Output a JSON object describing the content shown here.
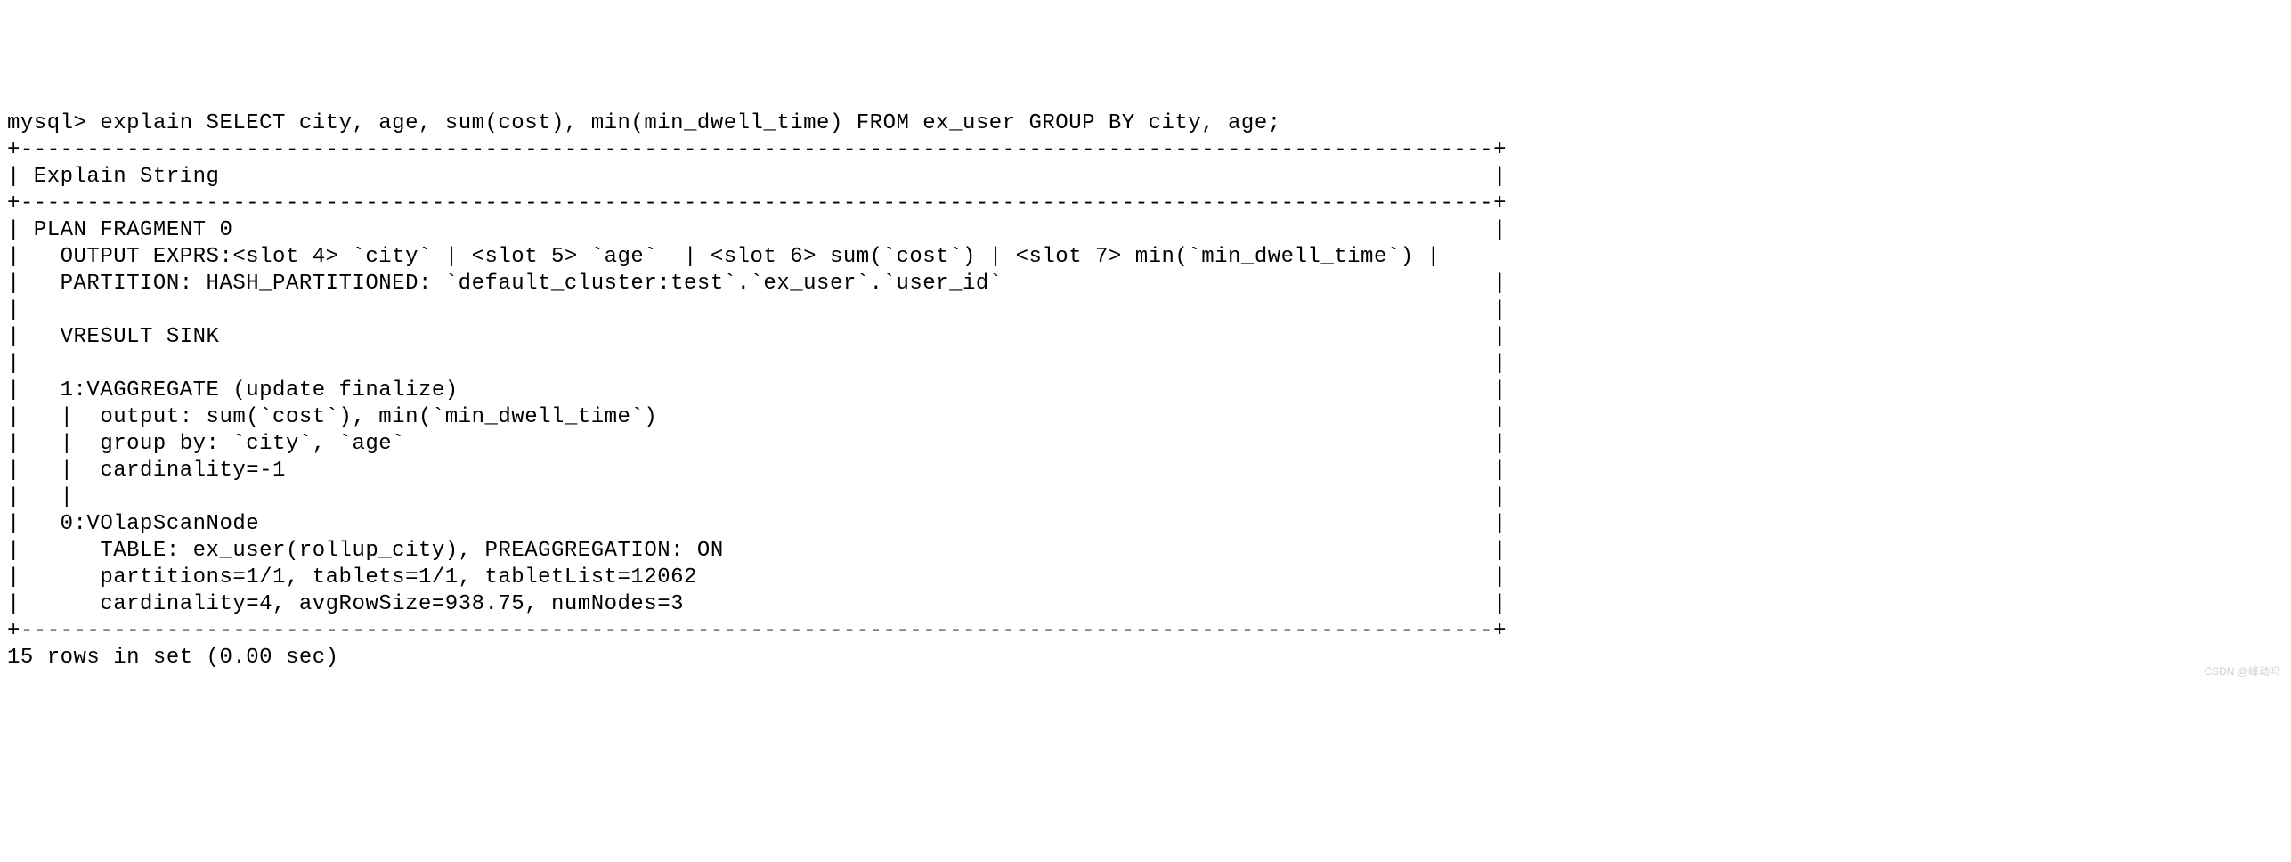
{
  "terminal": {
    "prompt": "mysql> ",
    "command": "explain SELECT city, age, sum(cost), min(min_dwell_time) FROM ex_user GROUP BY city, age;",
    "table_border_top": "+---------------------------------------------------------------------------------------------------------------+",
    "header_row": "| Explain String                                                                                                |",
    "table_border_mid": "+---------------------------------------------------------------------------------------------------------------+",
    "plan_lines": [
      "| PLAN FRAGMENT 0                                                                                               |",
      "|   OUTPUT EXPRS:<slot 4> `city` | <slot 5> `age`  | <slot 6> sum(`cost`) | <slot 7> min(`min_dwell_time`) |",
      "|   PARTITION: HASH_PARTITIONED: `default_cluster:test`.`ex_user`.`user_id`                                     |",
      "|                                                                                                               |",
      "|   VRESULT SINK                                                                                                |",
      "|                                                                                                               |",
      "|   1:VAGGREGATE (update finalize)                                                                              |",
      "|   |  output: sum(`cost`), min(`min_dwell_time`)                                                               |",
      "|   |  group by: `city`, `age`                                                                                  |",
      "|   |  cardinality=-1                                                                                           |",
      "|   |                                                                                                           |",
      "|   0:VOlapScanNode                                                                                             |",
      "|      TABLE: ex_user(rollup_city), PREAGGREGATION: ON                                                          |",
      "|      partitions=1/1, tablets=1/1, tabletList=12062                                                            |",
      "|      cardinality=4, avgRowSize=938.75, numNodes=3                                                             |"
    ],
    "table_border_bottom": "+---------------------------------------------------------------------------------------------------------------+",
    "result_footer": "15 rows in set (0.00 sec)"
  },
  "watermark": "CSDN @峰动吗"
}
